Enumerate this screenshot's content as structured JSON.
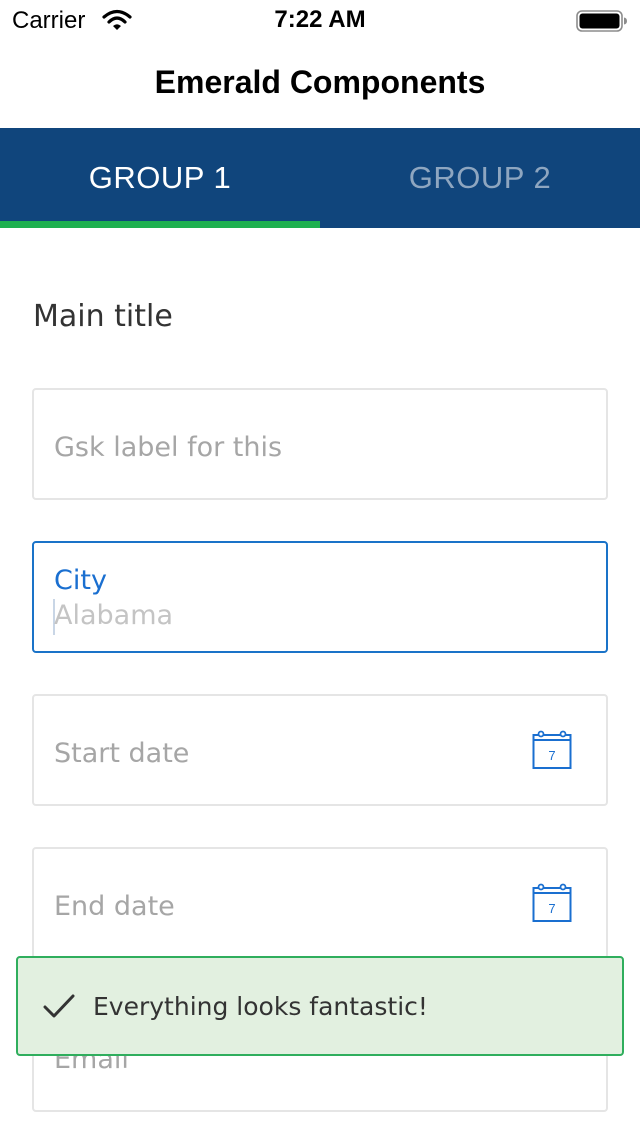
{
  "status_bar": {
    "carrier": "Carrier",
    "time": "7:22 AM",
    "wifi_icon": "wifi-icon",
    "battery_icon": "battery-full-icon"
  },
  "nav": {
    "title": "Emerald Components"
  },
  "tabs": [
    {
      "label": "GROUP 1",
      "active": true
    },
    {
      "label": "GROUP 2",
      "active": false
    }
  ],
  "main": {
    "title": "Main title",
    "fields": {
      "gsk_label": {
        "placeholder": "Gsk label for this"
      },
      "city": {
        "label": "City",
        "value": "Alabama"
      },
      "start_date": {
        "placeholder": "Start date",
        "icon": "calendar-icon",
        "icon_day": "7"
      },
      "end_date": {
        "placeholder": "End date",
        "icon": "calendar-icon",
        "icon_day": "7"
      },
      "email": {
        "placeholder": "Email"
      }
    }
  },
  "toast": {
    "icon": "check-icon",
    "message": "Everything looks fantastic!"
  },
  "colors": {
    "tab_bar": "#10457c",
    "tab_indicator": "#1eb050",
    "focus_border": "#1a73c8",
    "toast_background": "#e2f0e0",
    "toast_border": "#2fae5d"
  }
}
